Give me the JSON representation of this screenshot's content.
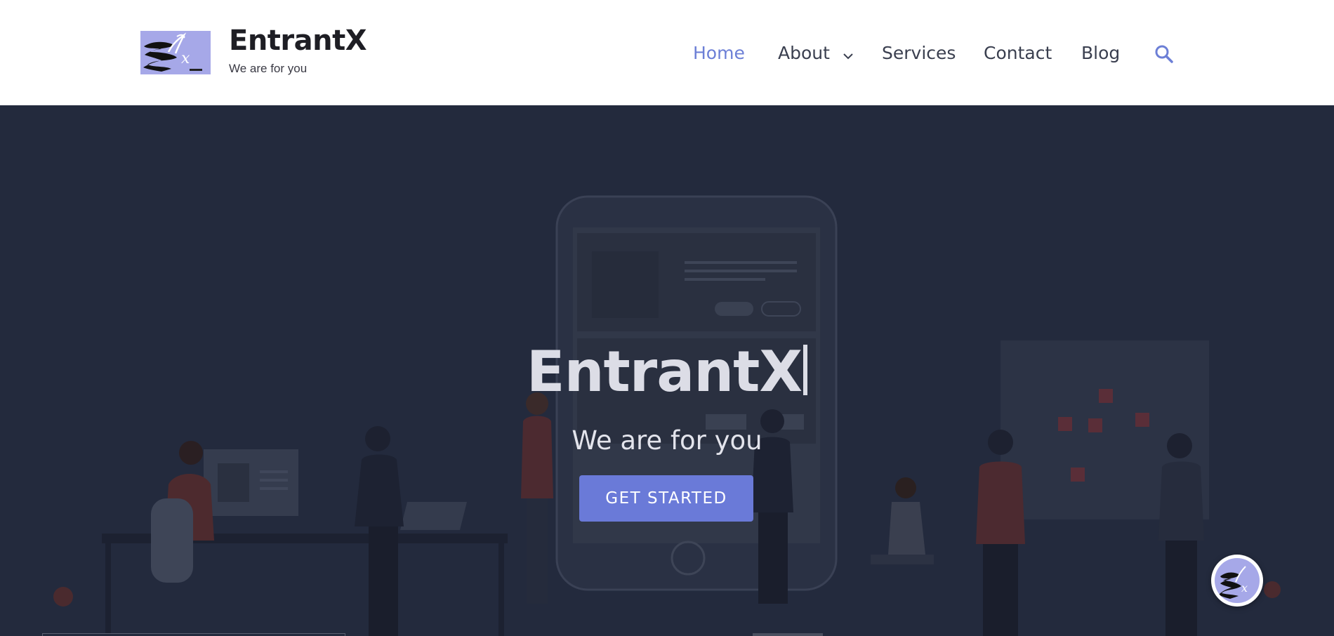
{
  "header": {
    "site_title": "EntrantX",
    "site_tagline": "We are for you",
    "logo_icon": "brand-logo-icon"
  },
  "nav": {
    "items": [
      {
        "label": "Home",
        "active": true
      },
      {
        "label": "About",
        "has_dropdown": true
      },
      {
        "label": "Services"
      },
      {
        "label": "Contact"
      },
      {
        "label": "Blog"
      }
    ],
    "search_icon": "search-icon"
  },
  "hero": {
    "title": "EntrantX",
    "subtitle": "We are for you",
    "cta_label": "GET STARTED"
  },
  "chat_widget": {
    "icon": "brand-logo-icon"
  },
  "colors": {
    "accent": "#6a7ad8",
    "nav_active": "#6c7fd6",
    "hero_background": "#232a3d",
    "logo_background": "#a6a8e8"
  }
}
